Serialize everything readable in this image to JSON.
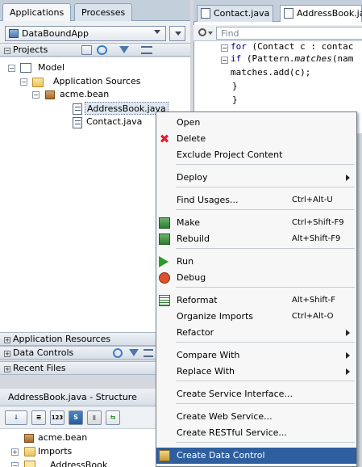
{
  "left_panel": {
    "tabs": [
      "Applications",
      "Processes"
    ],
    "app_selector": "DataBoundApp",
    "projects_header": "Projects",
    "tree": {
      "model": "Model",
      "app_sources": "Application Sources",
      "package": "acme.bean",
      "files": [
        "AddressBook.java",
        "Contact.java"
      ]
    },
    "accordion": {
      "app_resources": "Application Resources",
      "data_controls": "Data Controls",
      "recent_files": "Recent Files"
    }
  },
  "editor": {
    "tabs": [
      "Contact.java",
      "AddressBook.jav"
    ],
    "find_placeholder": "Find",
    "code_lines": {
      "l1_kw": "for",
      "l1_rest": " (Contact c : contac",
      "l2_kw": "if",
      "l2_rest": " (Pattern.",
      "l2_ital": "matches",
      "l2_end": "(nam",
      "l3": "matches.add(c);",
      "l4": "}",
      "l5": "}"
    }
  },
  "context_menu": {
    "items": [
      {
        "label": "Open",
        "shortcut": ""
      },
      {
        "label": "Delete",
        "shortcut": ""
      },
      {
        "label": "Exclude Project Content",
        "shortcut": ""
      },
      {
        "label": "Deploy",
        "shortcut": ""
      },
      {
        "label": "Find Usages...",
        "shortcut": "Ctrl+Alt-U"
      },
      {
        "label": "Make",
        "shortcut": "Ctrl+Shift-F9"
      },
      {
        "label": "Rebuild",
        "shortcut": "Alt+Shift-F9"
      },
      {
        "label": "Run",
        "shortcut": ""
      },
      {
        "label": "Debug",
        "shortcut": ""
      },
      {
        "label": "Reformat",
        "shortcut": "Alt+Shift-F"
      },
      {
        "label": "Organize Imports",
        "shortcut": "Ctrl+Alt-O"
      },
      {
        "label": "Refactor",
        "shortcut": ""
      },
      {
        "label": "Compare With",
        "shortcut": ""
      },
      {
        "label": "Replace With",
        "shortcut": ""
      },
      {
        "label": "Create Service Interface...",
        "shortcut": ""
      },
      {
        "label": "Create Web Service...",
        "shortcut": ""
      },
      {
        "label": "Create RESTful Service...",
        "shortcut": ""
      },
      {
        "label": "Create Data Control",
        "shortcut": ""
      }
    ]
  },
  "structure_panel": {
    "title": "AddressBook.java - Structure",
    "nodes": [
      "acme.bean",
      "Imports",
      "AddressBook"
    ]
  },
  "colors": {
    "highlight": "#2e5e9e",
    "tab_strip": "#c4cfdc"
  }
}
